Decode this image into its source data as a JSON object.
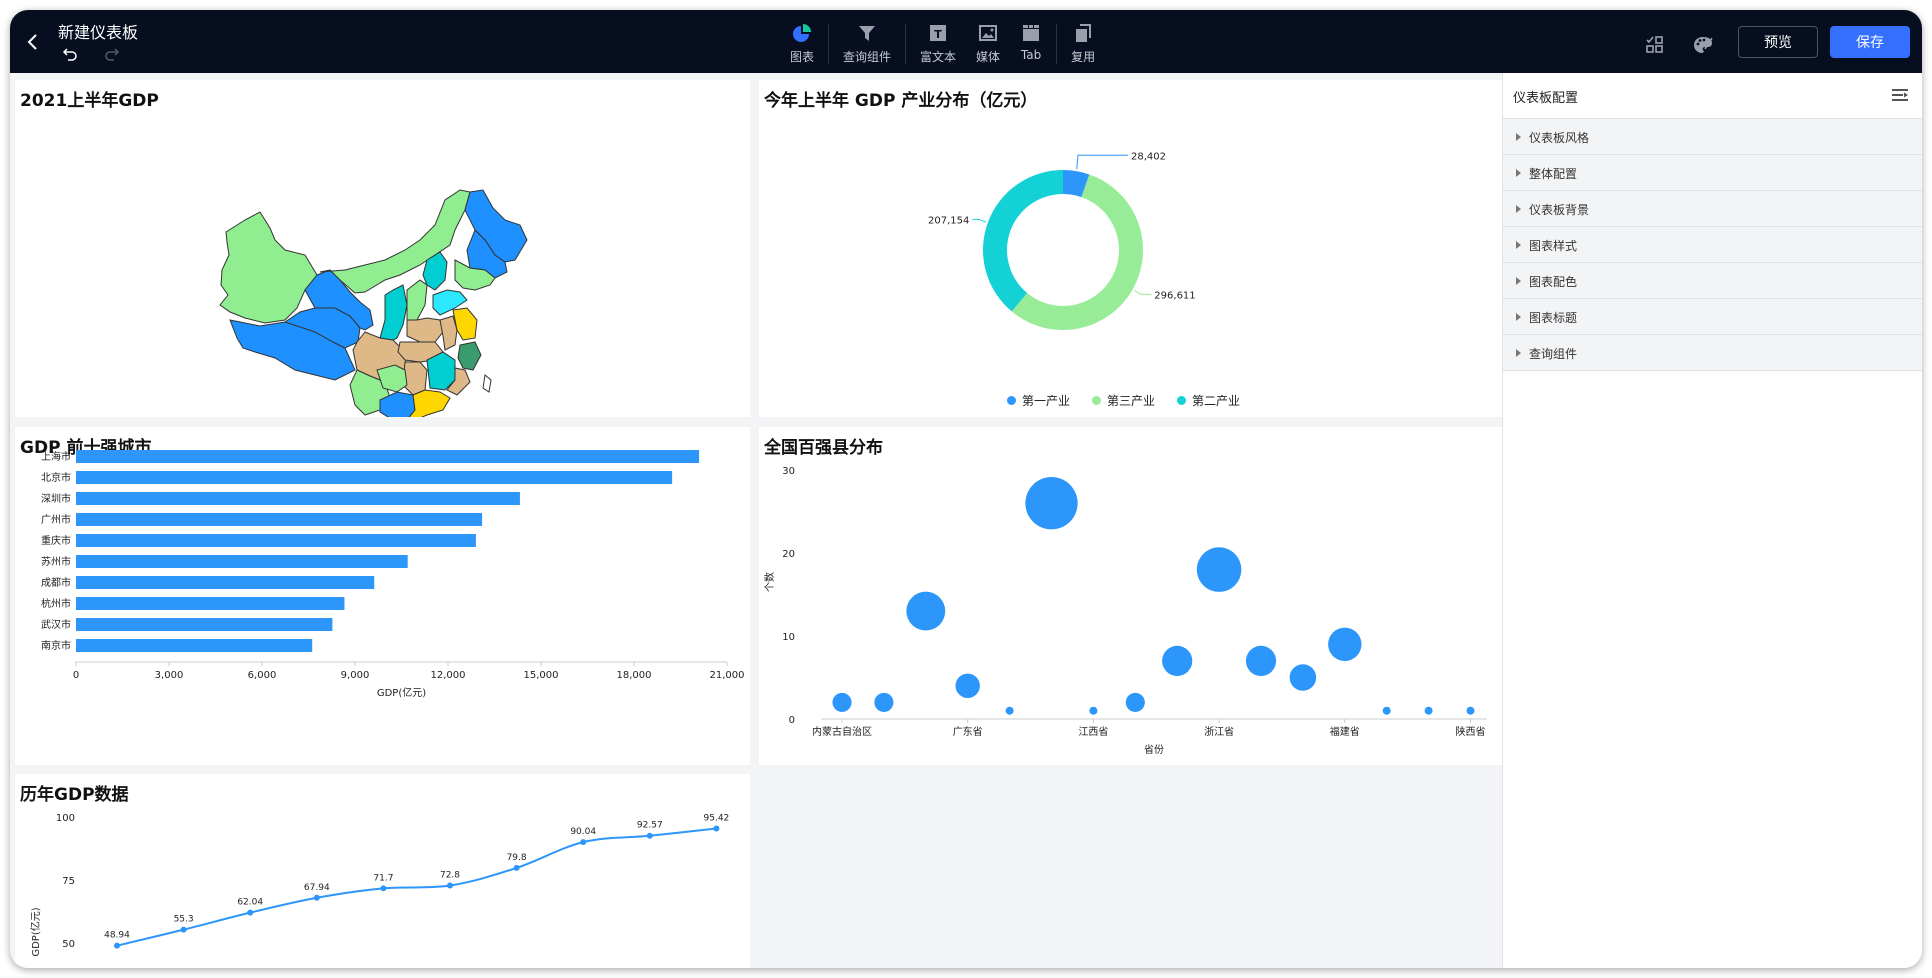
{
  "header": {
    "title": "新建仪表板",
    "toolbar": [
      {
        "id": "chart",
        "label": "图表",
        "icon": "pie-chart-icon"
      },
      {
        "id": "query",
        "label": "查询组件",
        "icon": "filter-icon"
      },
      {
        "id": "richtext",
        "label": "富文本",
        "icon": "text-icon"
      },
      {
        "id": "media",
        "label": "媒体",
        "icon": "image-icon"
      },
      {
        "id": "tab",
        "label": "Tab",
        "icon": "tab-icon"
      },
      {
        "id": "reuse",
        "label": "复用",
        "icon": "copy-icon"
      }
    ],
    "preview_label": "预览",
    "save_label": "保存",
    "accent": "#3370ff"
  },
  "config_panel": {
    "title": "仪表板配置",
    "items": [
      "仪表板风格",
      "整体配置",
      "仪表板背景",
      "图表样式",
      "图表配色",
      "图表标题",
      "查询组件"
    ]
  },
  "cards": {
    "map": {
      "title": "2021上半年GDP"
    },
    "donut": {
      "title": "今年上半年 GDP 产业分布（亿元）"
    },
    "bar": {
      "title": "GDP 前十强城市"
    },
    "bubble": {
      "title": "全国百强县分布"
    },
    "line": {
      "title": "历年GDP数据"
    }
  },
  "chart_data": [
    {
      "type": "map",
      "title": "2021上半年GDP",
      "region": "China provinces",
      "palette": [
        "#1e90ff",
        "#90ee90",
        "#00ced1",
        "#deb887",
        "#ffd700",
        "#3a9b6f",
        "#2be8ff"
      ]
    },
    {
      "type": "pie",
      "title": "今年上半年 GDP 产业分布（亿元）",
      "donut": true,
      "categories": [
        "第一产业",
        "第三产业",
        "第二产业"
      ],
      "values": [
        28402,
        296611,
        207154
      ],
      "value_labels": [
        "28,402",
        "296,611",
        "207,154"
      ],
      "colors": [
        "#2d96fb",
        "#98ec98",
        "#13d1d4"
      ],
      "legend": "bottom"
    },
    {
      "type": "bar",
      "orientation": "horizontal",
      "title": "GDP 前十强城市",
      "categories": [
        "上海市",
        "北京市",
        "深圳市",
        "广州市",
        "重庆市",
        "苏州市",
        "成都市",
        "杭州市",
        "武汉市",
        "南京市"
      ],
      "values": [
        20100,
        19230,
        14320,
        13100,
        12900,
        10700,
        9620,
        8660,
        8270,
        7620
      ],
      "xlabel": "GDP(亿元)",
      "ylabel": "",
      "xlim": [
        0,
        21000
      ],
      "xticks": [
        "0",
        "3,000",
        "6,000",
        "9,000",
        "12,000",
        "15,000",
        "18,000",
        "21,000"
      ],
      "color": "#2d96fb"
    },
    {
      "type": "scatter",
      "subtype": "bubble",
      "title": "全国百强县分布",
      "xlabel": "省份",
      "ylabel": "个数",
      "ylim": [
        0,
        30
      ],
      "yticks": [
        "0",
        "10",
        "20",
        "30"
      ],
      "x_tick_labels": [
        "内蒙古自治区",
        "广东省",
        "江西省",
        "浙江省",
        "福建省",
        "陕西省"
      ],
      "x_tick_indices": [
        0,
        3,
        6,
        9,
        12,
        15
      ],
      "values": [
        2,
        2,
        13,
        4,
        1,
        26,
        1,
        2,
        7,
        18,
        7,
        5,
        9,
        1,
        1,
        1
      ],
      "color": "#2d96fb"
    },
    {
      "type": "line",
      "title": "历年GDP数据",
      "ylabel": "GDP(亿元)",
      "ylim": [
        50,
        100
      ],
      "yticks": [
        "50",
        "75",
        "100"
      ],
      "values": [
        48.94,
        55.3,
        62.04,
        67.94,
        71.7,
        72.8,
        79.8,
        90.04,
        92.57,
        95.42
      ],
      "value_labels": [
        "48.94",
        "55.3",
        "62.04",
        "67.94",
        "71.7",
        "72.8",
        "79.8",
        "90.04",
        "92.57",
        "95.42"
      ],
      "color": "#2d96fb",
      "smooth": true
    }
  ]
}
